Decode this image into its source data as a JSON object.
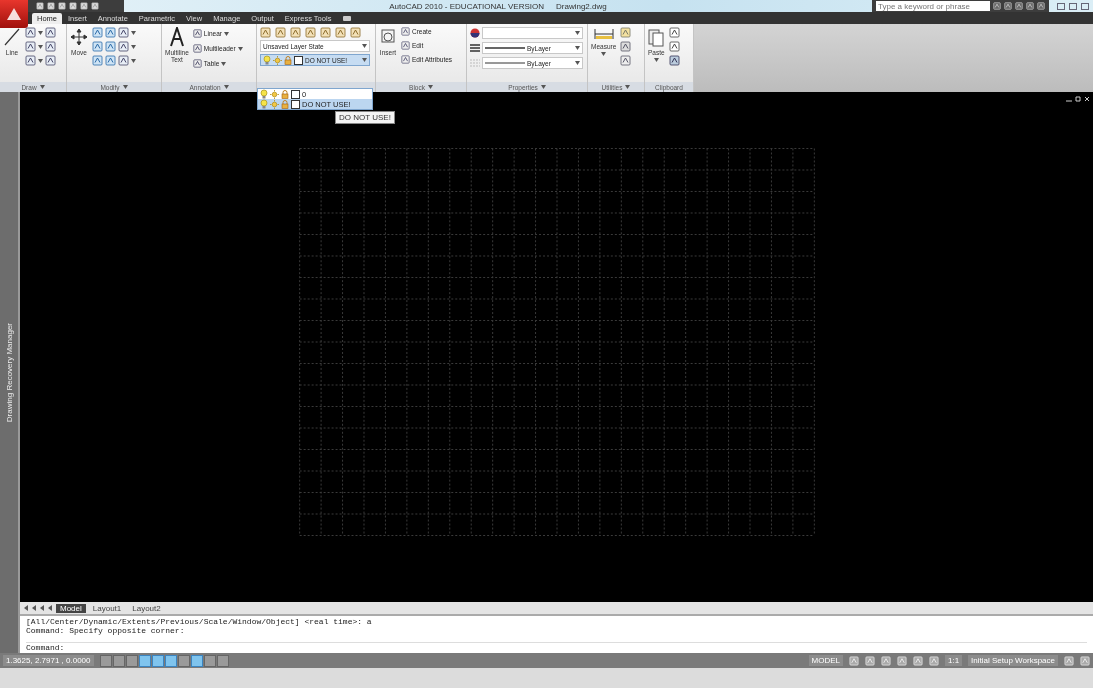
{
  "title_bar": {
    "title": "AutoCAD 2010 - EDUCATIONAL VERSION",
    "file": "Drawing2.dwg",
    "search": {
      "placeholder": "Type a keyword or phrase"
    }
  },
  "ribbon_tabs": [
    {
      "label": "Home",
      "selected": true
    },
    {
      "label": "Insert",
      "selected": false
    },
    {
      "label": "Annotate",
      "selected": false
    },
    {
      "label": "Parametric",
      "selected": false
    },
    {
      "label": "View",
      "selected": false
    },
    {
      "label": "Manage",
      "selected": false
    },
    {
      "label": "Output",
      "selected": false
    },
    {
      "label": "Express Tools",
      "selected": false
    }
  ],
  "ribbon_panels": [
    {
      "kind": "draw",
      "label": "Draw",
      "tool": "Line"
    },
    {
      "kind": "modify",
      "label": "Modify",
      "tool": "Move"
    },
    {
      "kind": "annotation",
      "label": "Annotation",
      "big_tool": [
        "Multiline",
        "Text"
      ],
      "tools": [
        "Linear",
        "Multileader",
        "Table"
      ]
    },
    {
      "kind": "layers",
      "layer_state": "Unsaved Layer State",
      "current_layer": "DO NOT USE!"
    },
    {
      "kind": "block",
      "label": "Block",
      "big_tool": "Insert",
      "tools": [
        "Create",
        "Edit",
        "Edit Attributes"
      ]
    },
    {
      "kind": "properties",
      "label": "Properties",
      "lineweight": "ByLayer",
      "linetype": "ByLayer"
    },
    {
      "kind": "utilities",
      "label": "Utilities",
      "tool": "Measure"
    },
    {
      "kind": "clipboard",
      "label": "Clipboard",
      "tool": "Paste"
    }
  ],
  "layer_dropdown": {
    "items": [
      {
        "name": "0",
        "selected": false
      },
      {
        "name": "DO NOT USE!",
        "selected": true
      }
    ],
    "tooltip": "DO NOT USE!"
  },
  "side_palette": {
    "title": "Drawing Recovery Manager"
  },
  "layout_tabs": [
    {
      "label": "Model",
      "selected": true
    },
    {
      "label": "Layout1",
      "selected": false
    },
    {
      "label": "Layout2",
      "selected": false
    }
  ],
  "command_history": [
    "[All/Center/Dynamic/Extents/Previous/Scale/Window/Object] <real time>: a",
    "Command: Specify opposite corner:"
  ],
  "command_prompt": "Command:",
  "status_bar": {
    "coordinates": "1.3625, 2.7971 , 0.0000",
    "toggles": [
      {
        "on": false
      },
      {
        "on": false
      },
      {
        "on": false
      },
      {
        "on": true
      },
      {
        "on": true
      },
      {
        "on": true
      },
      {
        "on": false
      },
      {
        "on": true
      },
      {
        "on": false
      },
      {
        "on": false
      }
    ],
    "space": "MODEL",
    "scale": "1:1",
    "workspace": "Initial Setup Workspace"
  }
}
